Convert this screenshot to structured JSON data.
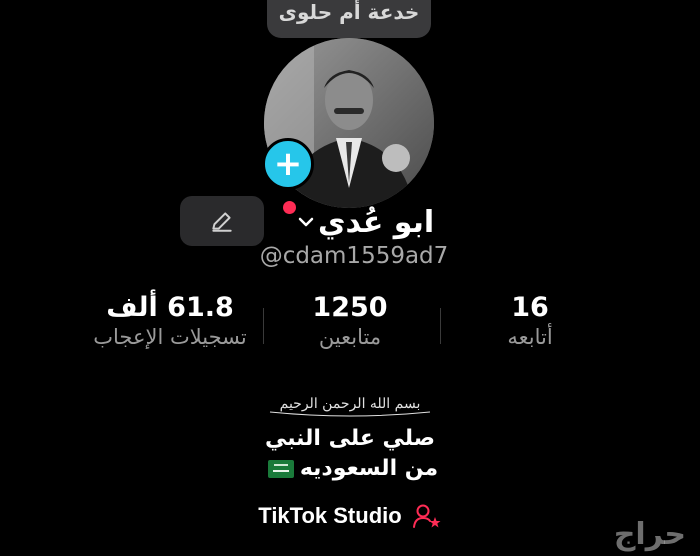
{
  "tooltip": {
    "text": "خدعة أم حلوى"
  },
  "profile": {
    "display_name": "ابو عُدي",
    "username": "@cdam1559ad7"
  },
  "stats": [
    {
      "value": "61.8 ألف",
      "label": "تسجيلات الإعجاب"
    },
    {
      "value": "1250",
      "label": "متابعين"
    },
    {
      "value": "16",
      "label": "أتابعه"
    }
  ],
  "bio": {
    "basmala": "بسم الله الرحمن الرحيم",
    "line1": "صلي على النبي",
    "line2": "من السعوديه"
  },
  "studio": {
    "label": "TikTok Studio"
  },
  "watermark": {
    "text": "حراج"
  },
  "colors": {
    "accent_blue": "#26c6ea",
    "notif_red": "#fe2c55",
    "background": "#000000"
  },
  "icons": {
    "add": "plus-icon",
    "edit": "pencil-icon",
    "dropdown": "chevron-down-icon",
    "studio": "person-star-icon",
    "flag": "saudi-flag-icon"
  }
}
